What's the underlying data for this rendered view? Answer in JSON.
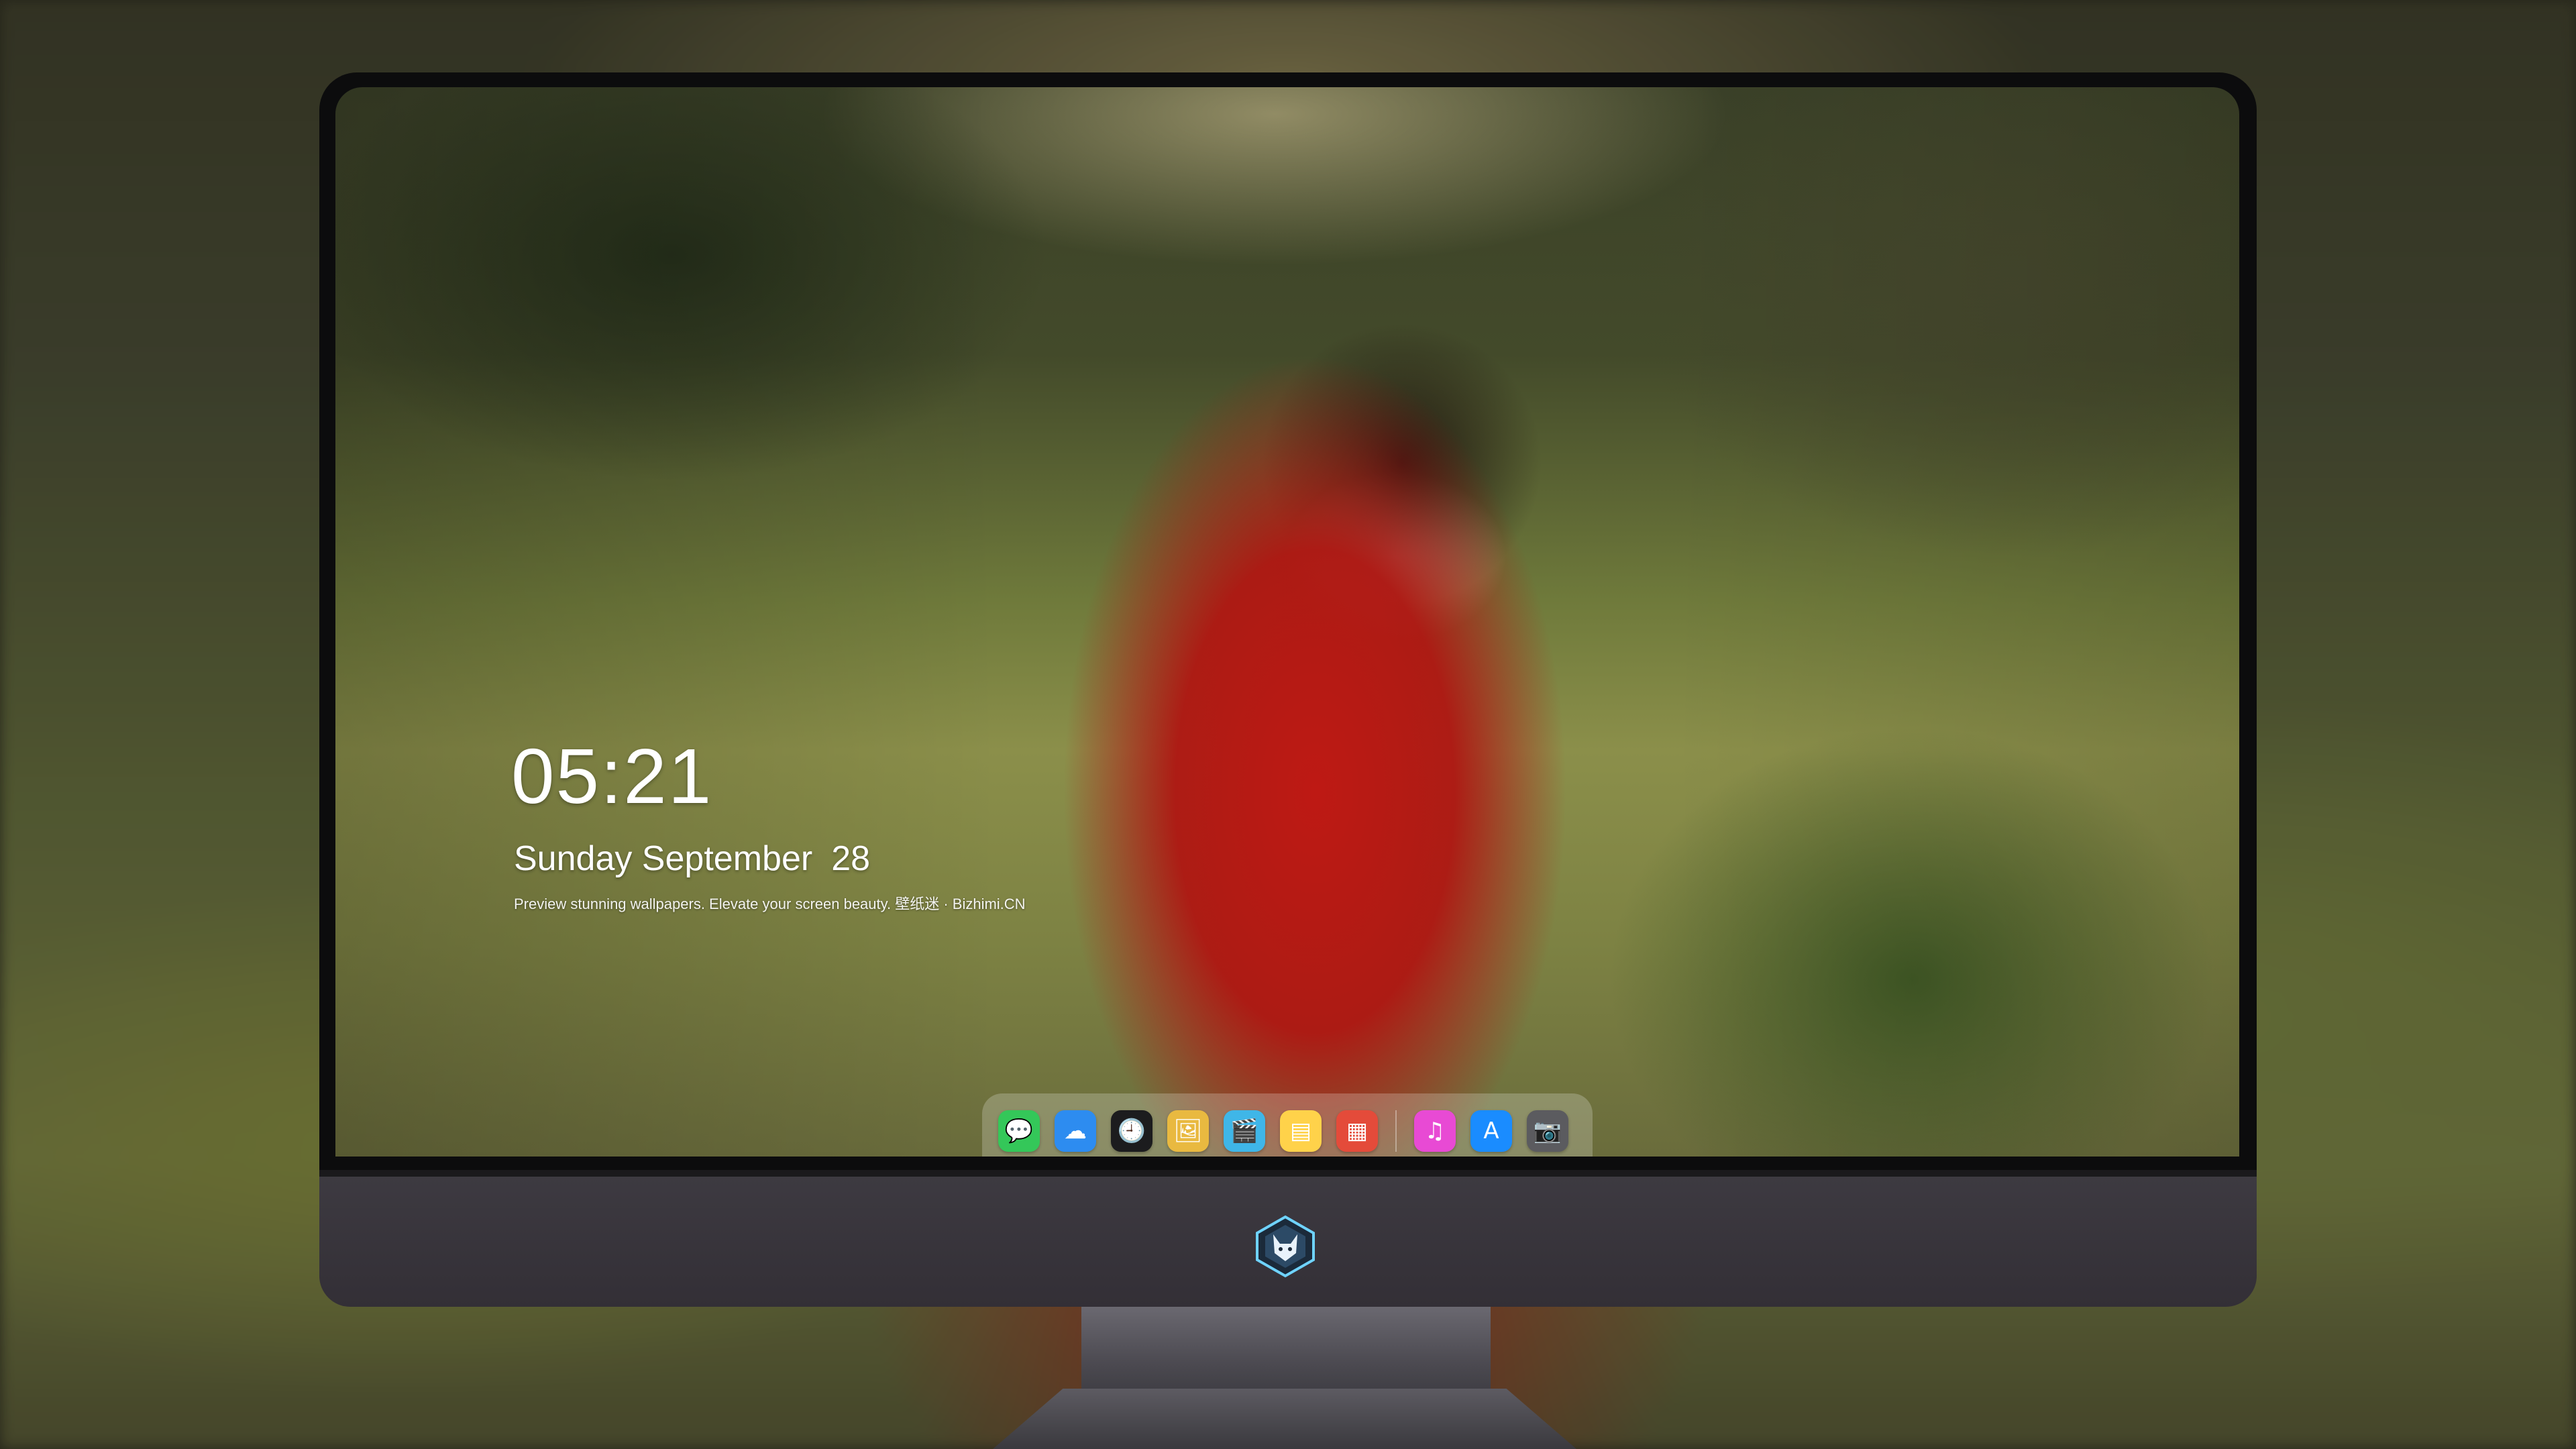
{
  "lock_screen": {
    "time": "05:21",
    "weekday_month": "Sunday September",
    "day": "28",
    "tagline": "Preview stunning wallpapers. Elevate your screen beauty. 壁纸迷 · Bizhimi.CN"
  },
  "dock": {
    "apps": [
      {
        "name": "messages-icon",
        "glyph": "💬",
        "color": "#34c759"
      },
      {
        "name": "weather-icon",
        "glyph": "☁",
        "color": "#2d8cf0"
      },
      {
        "name": "clock-icon",
        "glyph": "🕘",
        "color": "#1c1c1e"
      },
      {
        "name": "preview-icon",
        "glyph": "🖼",
        "color": "#e9b940"
      },
      {
        "name": "clips-icon",
        "glyph": "🎬",
        "color": "#3fb6e8"
      },
      {
        "name": "notes-icon",
        "glyph": "▤",
        "color": "#ffd24a"
      },
      {
        "name": "photo-booth-icon",
        "glyph": "▦",
        "color": "#e44b3a"
      },
      {
        "name": "music-icon",
        "glyph": "♫",
        "color": "#e84ad4"
      },
      {
        "name": "app-store-icon",
        "glyph": "A",
        "color": "#1a8cff"
      },
      {
        "name": "camera-icon",
        "glyph": "📷",
        "color": "#5b5b5f"
      }
    ]
  },
  "monitor": {
    "chin_logo": "wolf-logo-icon"
  }
}
